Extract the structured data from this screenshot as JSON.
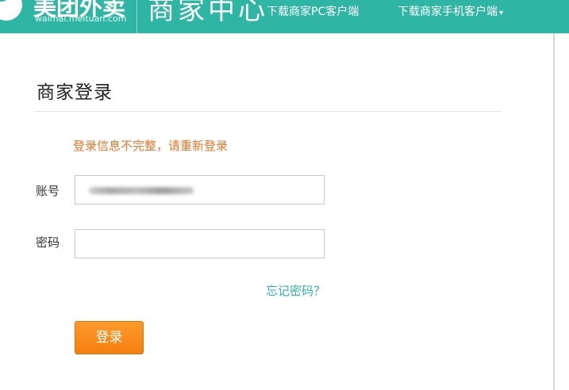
{
  "header": {
    "logo_text": "美团外卖",
    "logo_domain": "waimai.meituan.com",
    "brand_title": "商家中心",
    "nav_pc": "下载商家PC客户端",
    "nav_mobile": "下载商家手机客户端",
    "nav_mobile_caret": "▾"
  },
  "login": {
    "title": "商家登录",
    "error_message": "登录信息不完整，请重新登录",
    "account_label": "账号",
    "password_label": "密码",
    "forgot_password": "忘记密码？",
    "submit_label": "登录"
  },
  "colors": {
    "header_bg": "#2fb5a4",
    "error_text": "#f0742a",
    "link_text": "#2fb5a4",
    "button_bg": "#f47f0d"
  }
}
